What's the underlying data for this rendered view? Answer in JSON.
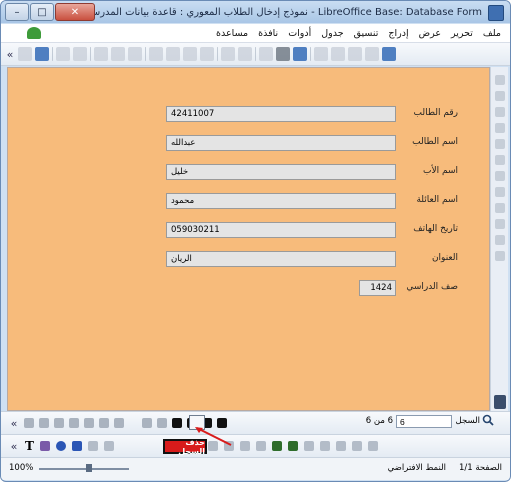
{
  "window": {
    "title": "LibreOffice Base: Database Form - نموذج إدخال الطلاب المعوري : قاعدة بيانات المدرسة.odb"
  },
  "menu": [
    "ملف",
    "تحرير",
    "عرض",
    "إدراج",
    "تنسيق",
    "جدول",
    "أدوات",
    "نافذة",
    "مساعدة"
  ],
  "form": {
    "fields": [
      {
        "label": "رقم الطالب",
        "value": "42411007"
      },
      {
        "label": "اسم الطالب",
        "value": "عبدالله"
      },
      {
        "label": "اسم الأب",
        "value": "خليل"
      },
      {
        "label": "اسم العائلة",
        "value": "محمود"
      },
      {
        "label": "تاريخ الهاتف",
        "value": "059030211"
      },
      {
        "label": "العنوان",
        "value": "الريان"
      },
      {
        "label": "صف الدراسي",
        "value": "1424"
      }
    ]
  },
  "navigation": {
    "record_label": "السجل",
    "record_value": "6",
    "of_text": "6 من 6"
  },
  "tooltip": {
    "text": "حذف السجل"
  },
  "status": {
    "zoom": "100%",
    "page": "الصفحة 1/1",
    "style": "النمط الافتراضي"
  },
  "colors": {
    "form_background": "#f7bb7b",
    "tooltip_background": "#d81b1b"
  }
}
